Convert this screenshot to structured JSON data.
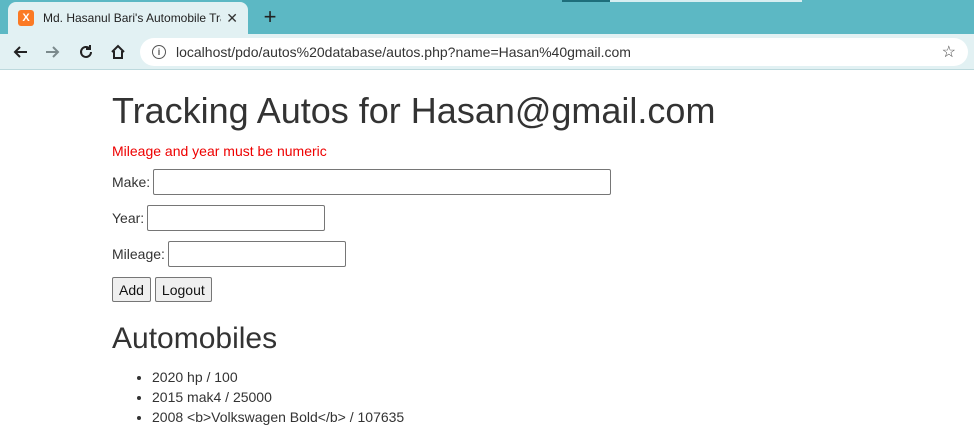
{
  "browser": {
    "tab_title": "Md. Hasanul Bari's Automobile Tracker",
    "tab_favicon": "X",
    "url": "localhost/pdo/autos%20database/autos.php?name=Hasan%40gmail.com",
    "icons": [
      "xampp-favicon-icon",
      "close-icon",
      "new-tab-icon",
      "back-icon",
      "forward-icon",
      "reload-icon",
      "home-icon",
      "info-icon",
      "star-icon"
    ]
  },
  "page": {
    "title": "Tracking Autos for Hasan@gmail.com",
    "error": "Mileage and year must be numeric",
    "form": {
      "make_label": "Make:",
      "year_label": "Year:",
      "mileage_label": "Mileage:",
      "make_value": "",
      "year_value": "",
      "mileage_value": "",
      "add_label": "Add",
      "logout_label": "Logout"
    },
    "section_title": "Automobiles",
    "autos": [
      "2020 hp / 100",
      "2015 mak4 / 25000",
      "2008 <b>Volkswagen Bold</b> / 107635"
    ]
  },
  "colors": {
    "tabbar": "#5cb8c4",
    "toolbar": "#e2f1f3",
    "error": "#ee0000",
    "favicon": "#fb7a24"
  }
}
